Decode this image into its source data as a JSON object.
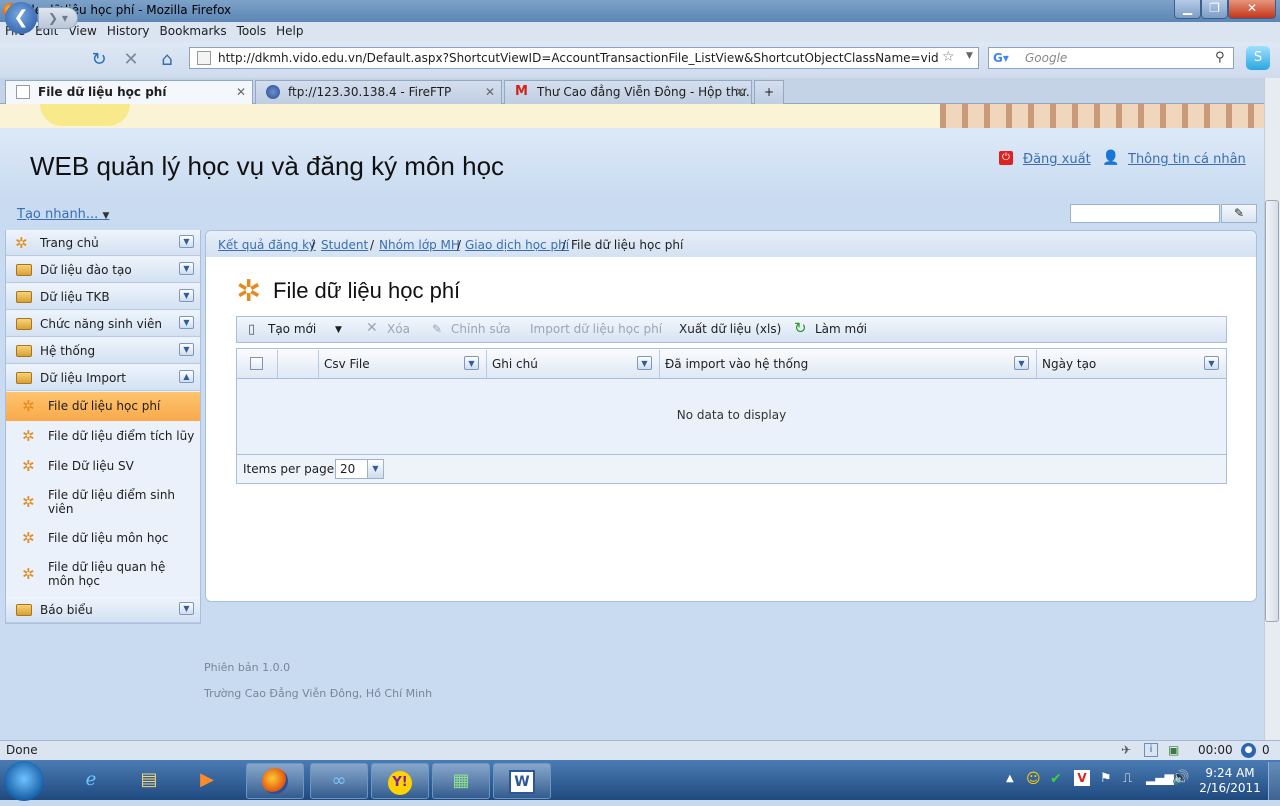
{
  "window": {
    "title": "File dữ liệu học phí - Mozilla Firefox"
  },
  "menu": [
    "File",
    "Edit",
    "View",
    "History",
    "Bookmarks",
    "Tools",
    "Help"
  ],
  "nav": {
    "url": "http://dkmh.vido.edu.vn/Default.aspx?ShortcutViewID=AccountTransactionFile_ListView&ShortcutObjectClassName=vidoSolution.Mod",
    "search_placeholder": "Google"
  },
  "tabs": [
    {
      "label": "File dữ liệu học phí"
    },
    {
      "label": "ftp://123.30.138.4 - FireFTP"
    },
    {
      "label": "Thư Cao đẳng Viễn Đông - Hộp thư..."
    }
  ],
  "app": {
    "title": "WEB quản lý học vụ và đăng ký môn học",
    "logout": "Đăng xuất",
    "profile": "Thông tin cá nhân",
    "quick_create": "Tạo nhanh..."
  },
  "sidebar": {
    "groups_top": [
      "Trang chủ",
      "Dữ liệu đào tạo",
      "Dữ liệu TKB",
      "Chức năng sinh viên",
      "Hệ thống",
      "Dữ liệu Import"
    ],
    "items": [
      "File dữ liệu học phí",
      "File dữ liệu điểm tích lũy",
      "File Dữ liệu SV",
      "File dữ liệu điểm sinh viên",
      "File dữ liệu môn học",
      "File dữ liệu quan hệ môn học"
    ],
    "group_bottom": "Báo biểu"
  },
  "breadcrumb": [
    "Kết quả đăng ký",
    "Student",
    "Nhóm lớp MH",
    "Giao dịch học phí",
    "File dữ liệu học phí"
  ],
  "page_title": "File dữ liệu học phí",
  "toolbar": {
    "new": "Tạo mới",
    "delete": "Xóa",
    "edit": "Chỉnh sửa",
    "import": "Import dữ liệu học phí",
    "export": "Xuất dữ liệu (xls)",
    "refresh": "Làm mới"
  },
  "grid": {
    "columns": [
      "Csv File",
      "Ghi chú",
      "Đã import vào hệ thống",
      "Ngày tạo"
    ],
    "empty": "No data to display",
    "items_per_page_label": "Items per page:",
    "items_per_page": "20"
  },
  "footer": {
    "version": "Phiên bản 1.0.0",
    "school": "Trường Cao Đẳng Viễn Đông, Hồ Chí Minh"
  },
  "status": {
    "text": "Done",
    "time": "00:00",
    "count": "0"
  },
  "clock": {
    "time": "9:24 AM",
    "date": "2/16/2011"
  }
}
